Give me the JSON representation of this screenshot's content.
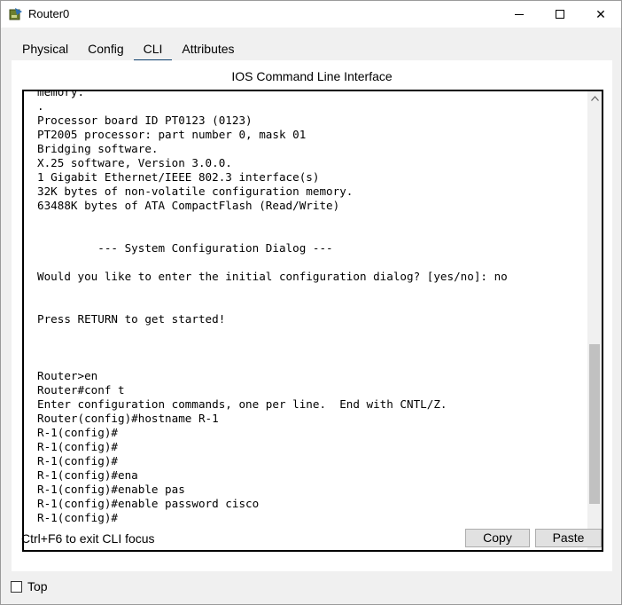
{
  "window": {
    "title": "Router0",
    "controls": {
      "minimize": "minimize",
      "maximize": "maximize",
      "close": "✕"
    }
  },
  "tabs": [
    {
      "label": "Physical",
      "active": false
    },
    {
      "label": "Config",
      "active": false
    },
    {
      "label": "CLI",
      "active": true
    },
    {
      "label": "Attributes",
      "active": false
    }
  ],
  "panel": {
    "heading": "IOS Command Line Interface",
    "terminal_lines": [
      "memory.",
      ".",
      "Processor board ID PT0123 (0123)",
      "PT2005 processor: part number 0, mask 01",
      "Bridging software.",
      "X.25 software, Version 3.0.0.",
      "1 Gigabit Ethernet/IEEE 802.3 interface(s)",
      "32K bytes of non-volatile configuration memory.",
      "63488K bytes of ATA CompactFlash (Read/Write)",
      "",
      "",
      "         --- System Configuration Dialog ---",
      "",
      "Would you like to enter the initial configuration dialog? [yes/no]: no",
      "",
      "",
      "Press RETURN to get started!",
      "",
      "",
      "",
      "Router>en",
      "Router#conf t",
      "Enter configuration commands, one per line.  End with CNTL/Z.",
      "Router(config)#hostname R-1",
      "R-1(config)#",
      "R-1(config)#",
      "R-1(config)#",
      "R-1(config)#ena",
      "R-1(config)#enable pas",
      "R-1(config)#enable password cisco",
      "R-1(config)#"
    ],
    "footer_hint": "Ctrl+F6 to exit CLI focus",
    "copy_label": "Copy",
    "paste_label": "Paste"
  },
  "top_checkbox": {
    "label": "Top",
    "checked": false
  },
  "icons": {
    "app": "router-app-icon",
    "scroll_up": "chevron-up-icon",
    "scroll_down": "chevron-down-icon"
  }
}
